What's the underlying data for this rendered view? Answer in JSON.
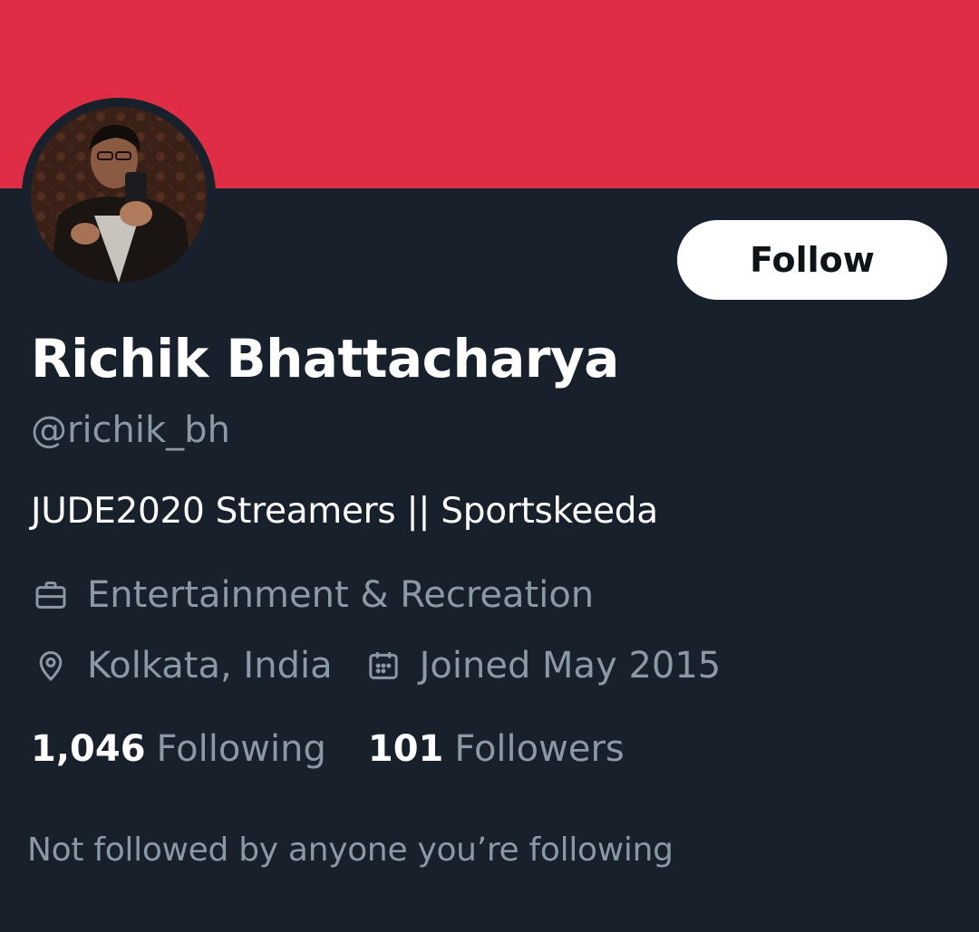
{
  "banner": {
    "color": "#de2d44"
  },
  "profile": {
    "display_name": "Richik Bhattacharya",
    "handle": "@richik_bh",
    "bio": "JUDE2020 Streamers || Sportskeeda",
    "category": "Entertainment & Recreation",
    "location": "Kolkata, India",
    "joined": "Joined May 2015"
  },
  "actions": {
    "follow_label": "Follow"
  },
  "stats": {
    "following_count": "1,046",
    "following_label": "Following",
    "followers_count": "101",
    "followers_label": "Followers"
  },
  "social_context": "Not followed by anyone you’re following",
  "icons": {
    "category": "briefcase-icon",
    "location": "location-pin-icon",
    "joined": "calendar-icon"
  },
  "colors": {
    "background": "#17202b",
    "text_primary": "#ffffff",
    "text_secondary": "#8b98a5",
    "button_bg": "#ffffff",
    "button_text": "#0f1419"
  }
}
